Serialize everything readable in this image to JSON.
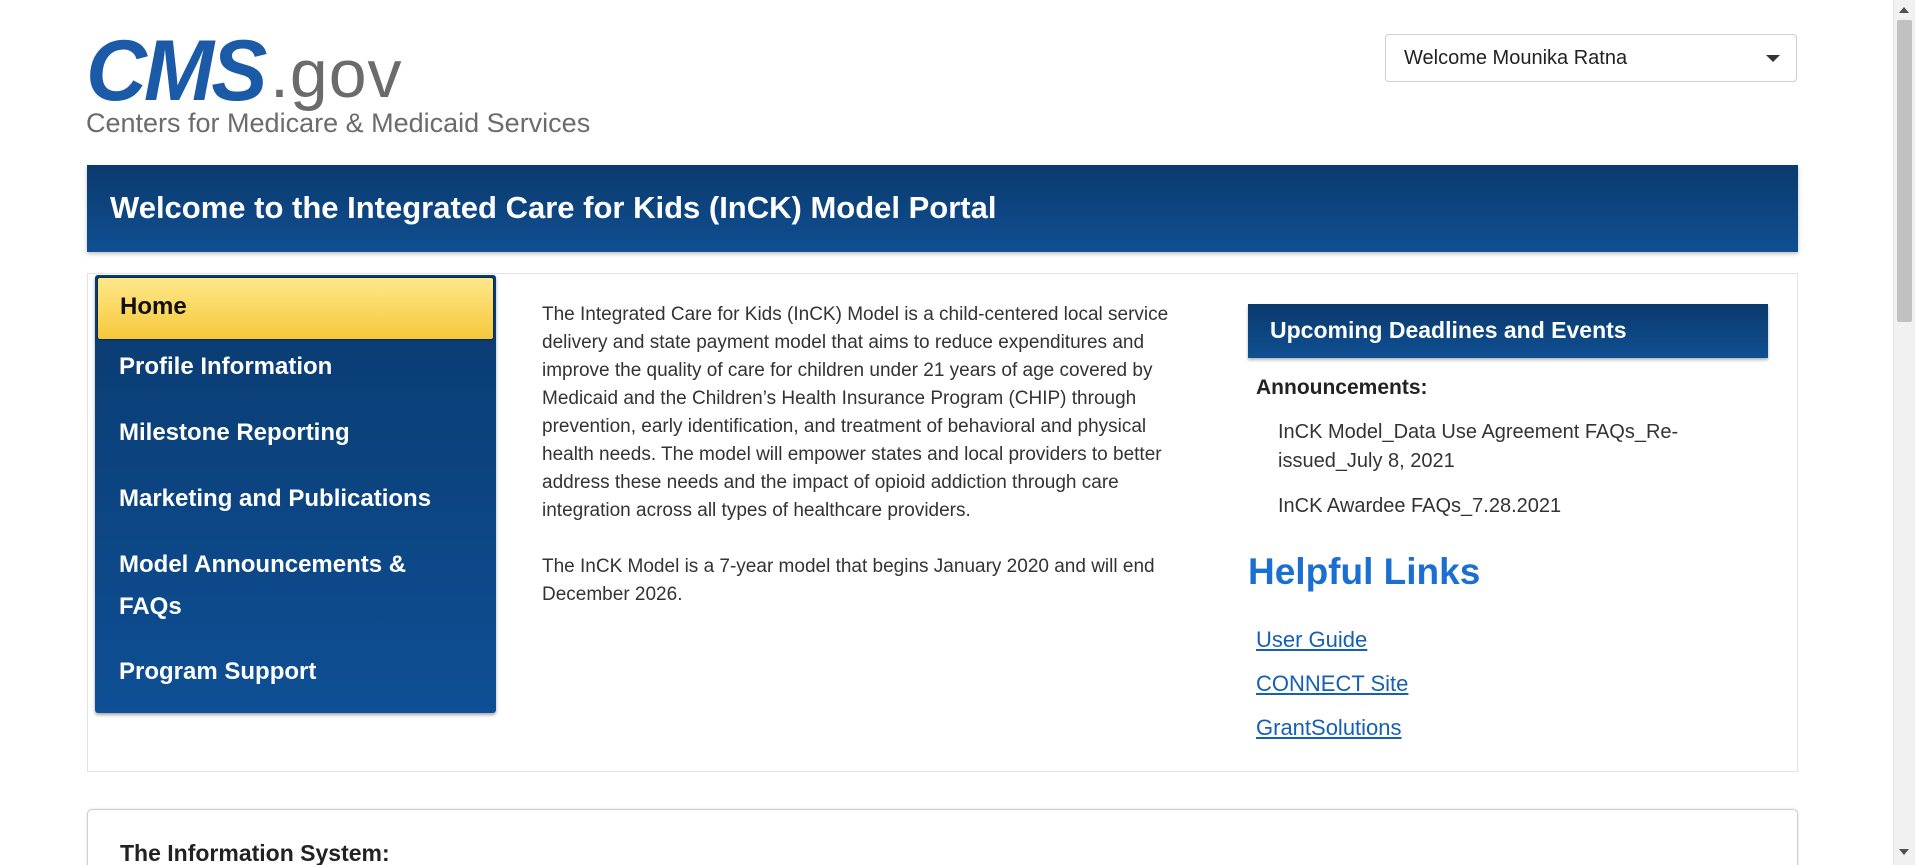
{
  "logo": {
    "cms": "CMS",
    "gov": ".gov",
    "subtitle": "Centers for Medicare & Medicaid Services"
  },
  "user_menu": {
    "label": "Welcome Mounika Ratna"
  },
  "banner": {
    "title": "Welcome to the Integrated Care for Kids (InCK) Model Portal"
  },
  "nav": {
    "items": [
      {
        "label": "Home",
        "active": true
      },
      {
        "label": "Profile Information"
      },
      {
        "label": "Milestone Reporting"
      },
      {
        "label": "Marketing and Publications"
      },
      {
        "label": "Model Announcements &",
        "label2": "FAQs"
      },
      {
        "label": "Program Support"
      }
    ]
  },
  "intro": {
    "paragraph1": "The Integrated Care for Kids (InCK) Model is a child-centered local service delivery and state payment model that aims to reduce expenditures and improve the quality of care for children under 21 years of age covered by Medicaid and the Children’s Health Insurance Program (CHIP) through prevention, early identification, and treatment of behavioral and physical health needs. The model will empower states and local providers to better address these needs and the impact of opioid addiction through care integration across all types of healthcare providers.",
    "paragraph2": "The InCK Model is a 7-year model that begins January 2020 and will end December 2026."
  },
  "deadlines": {
    "title": "Upcoming Deadlines and Events",
    "announcements_label": "Announcements:",
    "items": [
      "InCK Model_Data Use Agreement FAQs_Re-issued_July 8, 2021",
      "InCK Awardee FAQs_7.28.2021"
    ]
  },
  "helpful_links": {
    "title": "Helpful Links",
    "links": [
      "User Guide",
      "CONNECT Site",
      "GrantSolutions"
    ]
  },
  "info_system": {
    "title": "The Information System:"
  }
}
